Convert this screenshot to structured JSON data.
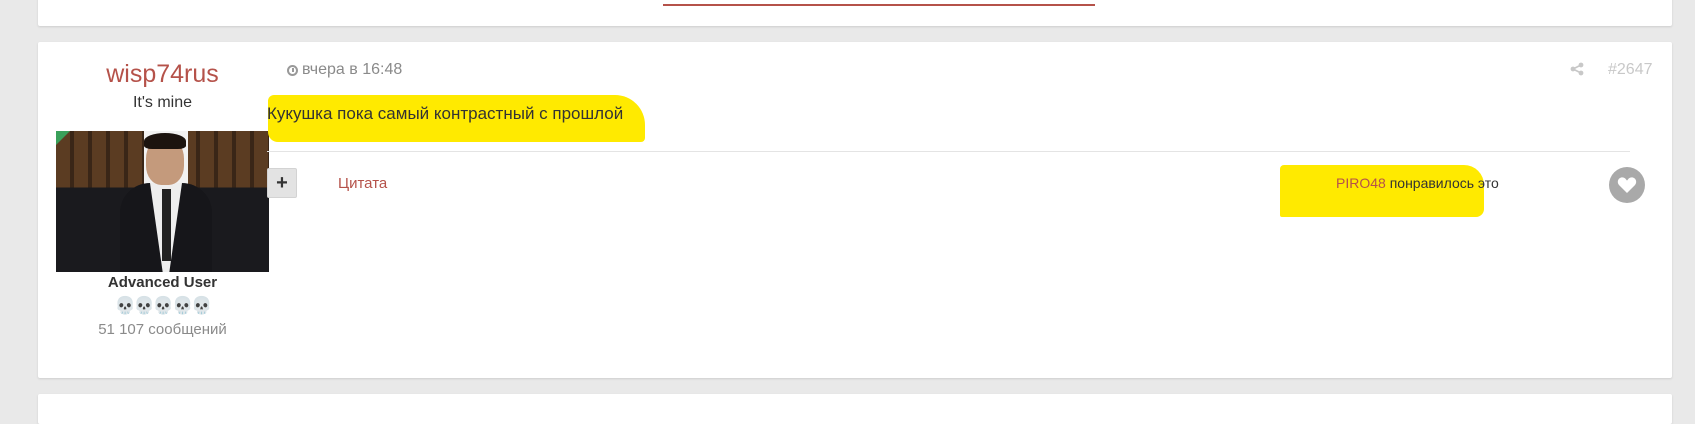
{
  "post": {
    "author": {
      "name": "wisp74rus",
      "title": "It's mine",
      "rank": "Advanced User",
      "reputation_icons": "💀💀💀💀💀",
      "post_count": "51 107 сообщений"
    },
    "timestamp": "вчера в 16:48",
    "number": "#2647",
    "body": "Кукушка пока самый контрастный с прошлой",
    "actions": {
      "plus": "+",
      "quote": "Цитата"
    },
    "likes": {
      "user": "PIRO48",
      "text": " понравилось это"
    }
  },
  "icons": {
    "clock": "clock-icon",
    "share": "share-icon",
    "like": "heart-icon"
  },
  "colors": {
    "accent": "#b5524a",
    "highlight": "#ffea00"
  }
}
